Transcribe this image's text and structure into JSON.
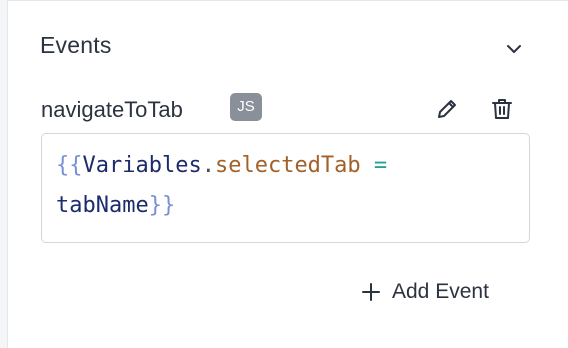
{
  "events_panel": {
    "title": "Events",
    "collapse_icon": "chevron-down-icon"
  },
  "event": {
    "name": "navigateToTab",
    "badge": "JS",
    "edit_icon": "pencil-icon",
    "delete_icon": "trash-icon",
    "code": {
      "open_braces": "{{",
      "object": "Variables",
      "dot": ".",
      "property": "selectedTab",
      "operator": "=",
      "value": "tabName",
      "close_braces": "}}"
    }
  },
  "add_event": {
    "label": "Add Event",
    "icon": "plus-icon"
  }
}
